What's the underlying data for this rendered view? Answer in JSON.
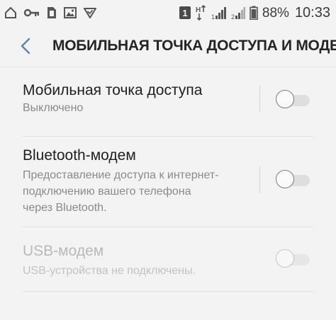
{
  "status_bar": {
    "left_icons": [
      "home-outline-icon",
      "key-icon",
      "sim-card-icon",
      "image-icon",
      "shield-check-icon"
    ],
    "notification_badge": "1",
    "battery_percent": "88%",
    "time": "10:33"
  },
  "header": {
    "title": "МОБИЛЬНАЯ ТОЧКА ДОСТУПА И МОДЕМ",
    "back_icon": "chevron-left-icon",
    "accent_color": "#5a87a8"
  },
  "items": [
    {
      "title": "Мобильная точка доступа",
      "subtitle": "Выключено",
      "enabled": true,
      "toggle_on": false
    },
    {
      "title": "Bluetooth-модем",
      "subtitle": "Предоставление доступа к интернет-\nподключению вашего телефона\nчерез Bluetooth.",
      "enabled": true,
      "toggle_on": false
    },
    {
      "title": "USB-модем",
      "subtitle": "USB-устройства не подключены.",
      "enabled": false,
      "toggle_on": false
    }
  ]
}
